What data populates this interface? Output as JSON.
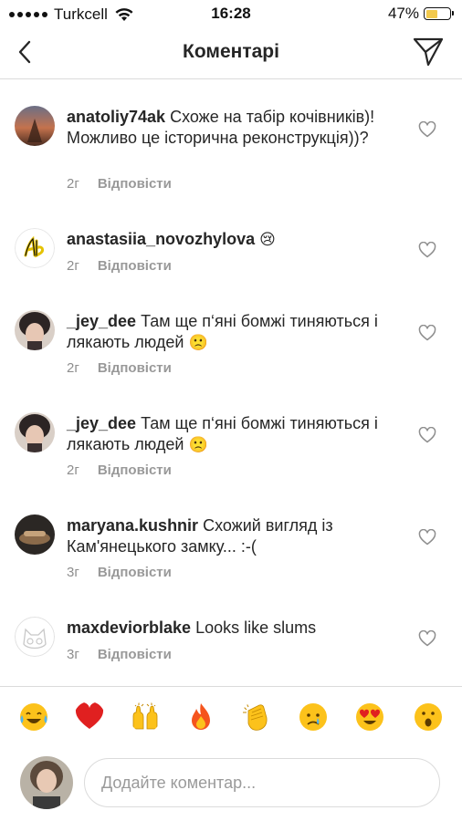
{
  "status_bar": {
    "carrier": "Turkcell",
    "time": "16:28",
    "battery": "47%"
  },
  "header": {
    "title": "Коментарі",
    "back_icon": "chevron-left-icon",
    "send_icon": "paper-plane-icon"
  },
  "comments": [
    {
      "username": "anatoliy74ak",
      "text": "Схоже на табір кочівників)! Можливо це історична реконструкція))?",
      "time": "2г",
      "reply_label": "Відповісти"
    },
    {
      "username": "anastasiia_novozhylova",
      "text": "",
      "emoji": "😢",
      "time": "2г",
      "reply_label": "Відповісти"
    },
    {
      "username": "_jey_dee",
      "text": "Там ще п‘яні бомжі тиняються і лякають людей",
      "emoji": "🙁",
      "time": "2г",
      "reply_label": "Відповісти"
    },
    {
      "username": "_jey_dee",
      "text": "Там ще п‘яні бомжі тиняються і лякають людей",
      "emoji": "🙁",
      "time": "2г",
      "reply_label": "Відповісти"
    },
    {
      "username": "maryana.kushnir",
      "text": "Схожий вигляд із Кам'янецького замку... :-(",
      "time": "3г",
      "reply_label": "Відповісти"
    },
    {
      "username": "maxdeviorblake",
      "text": "Looks like slums",
      "time": "3г",
      "reply_label": "Відповісти"
    }
  ],
  "emoji_bar": [
    "tears-of-joy",
    "red-heart",
    "raising-hands",
    "fire",
    "clapping-hands",
    "crying-face",
    "heart-eyes",
    "astonished-face"
  ],
  "comment_input": {
    "placeholder": "Додайте коментар..."
  }
}
